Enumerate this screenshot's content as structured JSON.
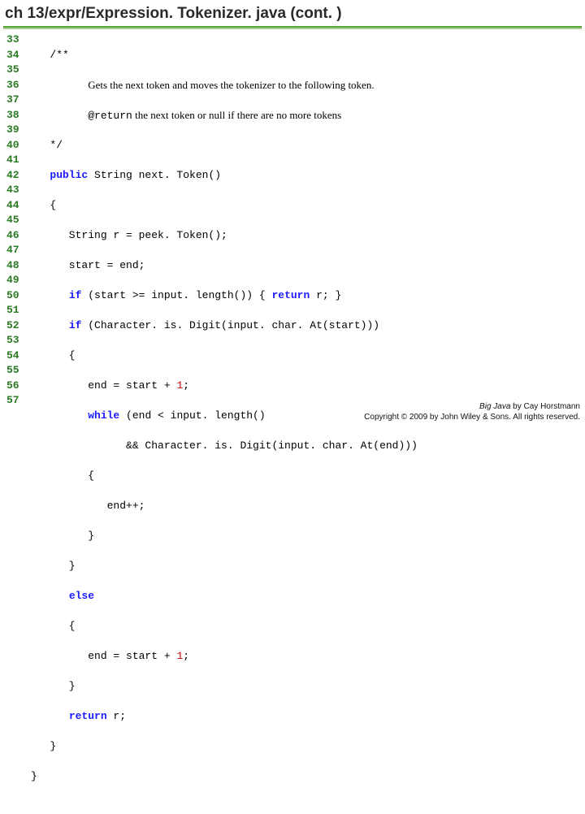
{
  "title": "ch 13/expr/Expression. Tokenizer. java (cont. )",
  "lineStart": 33,
  "lineEnd": 57,
  "code": {
    "l33": "   /**",
    "l34_a": "         ",
    "l34_b": "Gets the next token and moves the tokenizer to the following token.",
    "l35_a": "         ",
    "l35_b": "@return",
    "l35_c": " the next token or null if there are no more tokens",
    "l36": "   */",
    "l37_a": "   ",
    "l37_b": "public",
    "l37_c": " String next. Token()",
    "l38": "   {",
    "l39": "      String r = peek. Token();",
    "l40": "      start = end;",
    "l41_a": "      ",
    "l41_b": "if",
    "l41_c": " (start >= input. length()) { ",
    "l41_d": "return",
    "l41_e": " r; }",
    "l42_a": "      ",
    "l42_b": "if",
    "l42_c": " (Character. is. Digit(input. char. At(start)))",
    "l43": "      {",
    "l44_a": "         end = start + ",
    "l44_b": "1",
    "l44_c": ";",
    "l45_a": "         ",
    "l45_b": "while",
    "l45_c": " (end < input. length()",
    "l46": "               && Character. is. Digit(input. char. At(end)))",
    "l47": "         {",
    "l48": "            end++;",
    "l49": "         }",
    "l50": "      }",
    "l51_a": "      ",
    "l51_b": "else",
    "l52": "      {",
    "l53_a": "         end = start + ",
    "l53_b": "1",
    "l53_c": ";",
    "l54": "      }",
    "l55_a": "      ",
    "l55_b": "return",
    "l55_c": " r;",
    "l56": "   }",
    "l57": "}"
  },
  "footer": {
    "line1_a": "Big Java",
    "line1_b": " by Cay Horstmann",
    "line2": "Copyright © 2009 by John Wiley & Sons.  All rights reserved."
  }
}
